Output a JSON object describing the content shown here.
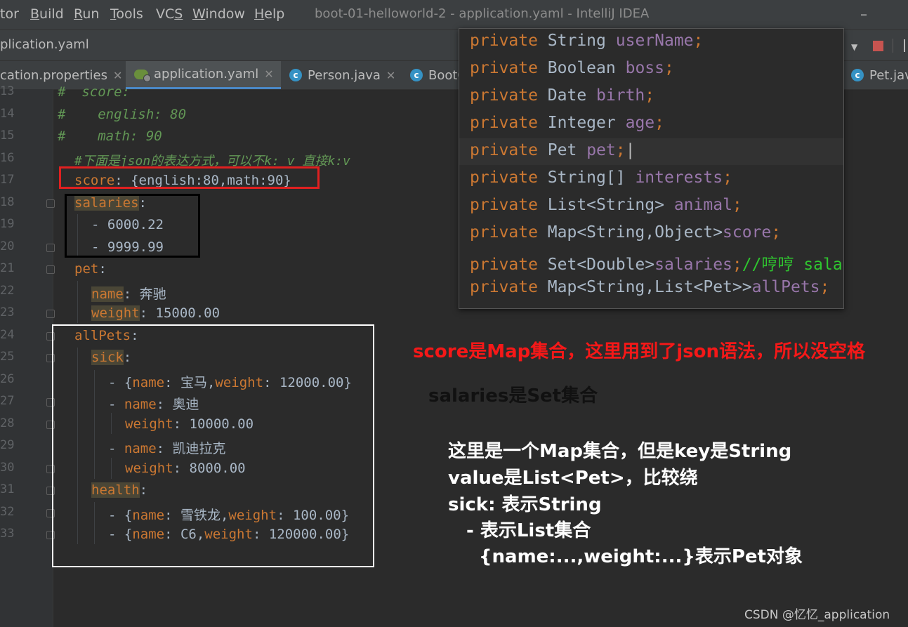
{
  "menu": [
    {
      "label": "tor",
      "ul": ""
    },
    {
      "label": "Build",
      "ul": "B"
    },
    {
      "label": "Run",
      "ul": "R"
    },
    {
      "label": "Tools",
      "ul": "T"
    },
    {
      "label": "VCS",
      "ul": "S"
    },
    {
      "label": "Window",
      "ul": "W"
    },
    {
      "label": "Help",
      "ul": "H"
    }
  ],
  "window_title": "boot-01-helloworld-2 - application.yaml - IntelliJ IDEA",
  "breadcrumb": "plication.yaml",
  "tabs": [
    {
      "label": "cation.properties",
      "icon": "properties-icon"
    },
    {
      "label": "application.yaml",
      "icon": "yaml-icon"
    },
    {
      "label": "Person.java",
      "icon": "class-icon"
    },
    {
      "label": "BootC",
      "icon": "class-icon"
    },
    {
      "label": "Pet.jav",
      "icon": "class-icon"
    }
  ],
  "line_numbers": [
    "13",
    "14",
    "15",
    "16",
    "17",
    "18",
    "19",
    "20",
    "21",
    "22",
    "23",
    "24",
    "25",
    "26",
    "27",
    "28",
    "29",
    "30",
    "31",
    "32",
    "33"
  ],
  "code": {
    "l13": "#  score:",
    "l14": "#    english: 80",
    "l15": "#    math: 90",
    "l16": "#下面是json的表达方式，可以不k: v 直接k:v",
    "l17_key": "score",
    "l17_val": ": {english:80,math:90}",
    "l18_key": "salaries",
    "l18_val": ":",
    "l19": "- 6000.22",
    "l20": "- 9999.99",
    "l21_key": "pet",
    "l21_val": ":",
    "l22_key": "name",
    "l22_val": ": 奔驰",
    "l23_key": "weight",
    "l23_val": ": 15000.00",
    "l24_key": "allPets",
    "l24_val": ":",
    "l25_key": "sick",
    "l25_val": ":",
    "l26_a": "- {",
    "l26_k1": "name",
    "l26_v1": ": 宝马,",
    "l26_k2": "weight",
    "l26_v2": ": 12000.00}",
    "l27_a": "- ",
    "l27_key": "name",
    "l27_val": ": 奥迪",
    "l28_key": "weight",
    "l28_val": ": 10000.00",
    "l29_a": "- ",
    "l29_key": "name",
    "l29_val": ": 凯迪拉克",
    "l30_key": "weight",
    "l30_val": ": 8000.00",
    "l31_key": "health",
    "l31_val": ":",
    "l32_a": "- {",
    "l32_k1": "name",
    "l32_v1": ": 雪铁龙,",
    "l32_k2": "weight",
    "l32_v2": ": 100.00}",
    "l33_a": "- {",
    "l33_k1": "name",
    "l33_v1": ": C6,",
    "l33_k2": "weight",
    "l33_v2": ": 120000.00}"
  },
  "popup": [
    {
      "kw": "private",
      "type": "String",
      "field": "userName",
      "semi": ";",
      "comment": ""
    },
    {
      "kw": "private",
      "type": "Boolean",
      "field": "boss",
      "semi": ";",
      "comment": ""
    },
    {
      "kw": "private",
      "type": "Date",
      "field": "birth",
      "semi": ";",
      "comment": ""
    },
    {
      "kw": "private",
      "type": "Integer",
      "field": "age",
      "semi": ";",
      "comment": ""
    },
    {
      "kw": "private",
      "type": "Pet",
      "field": "pet",
      "semi": ";",
      "comment": ""
    },
    {
      "kw": "private",
      "type": "String[]",
      "field": "interests",
      "semi": ";",
      "comment": ""
    },
    {
      "kw": "private",
      "type": "List<String>",
      "field": "animal",
      "semi": ";",
      "comment": ""
    },
    {
      "kw": "private",
      "type": "Map<String,Object>",
      "field": "score",
      "semi": ";",
      "comment": ""
    },
    {
      "kw": "private",
      "type": "Set<Double>",
      "field": "salaries",
      "semi": ";",
      "comment": "//哼哼 sala"
    },
    {
      "kw": "private",
      "type": "Map<String,List<Pet>>",
      "field": "allPets",
      "semi": ";",
      "comment": ""
    }
  ],
  "notes": {
    "score": "score是Map集合，这里用到了json语法，所以没空格",
    "salaries": "salaries是Set集合",
    "allpets_1": "这里是一个Map集合，但是key是String",
    "allpets_2": "value是List<Pet>，比较绕",
    "allpets_3": "sick: 表示String",
    "allpets_4": "- 表示List集合",
    "allpets_5": "{name:...,weight:...}表示Pet对象"
  },
  "watermark": "CSDN @忆忆_application",
  "colors": {
    "editor_bg": "#2b2b2b",
    "keyword": "#cc7832",
    "field": "#9876aa",
    "comment": "#629755",
    "note_red": "#f51818",
    "box_red": "#e02020",
    "box_black": "#000000",
    "box_white": "#ffffff"
  }
}
